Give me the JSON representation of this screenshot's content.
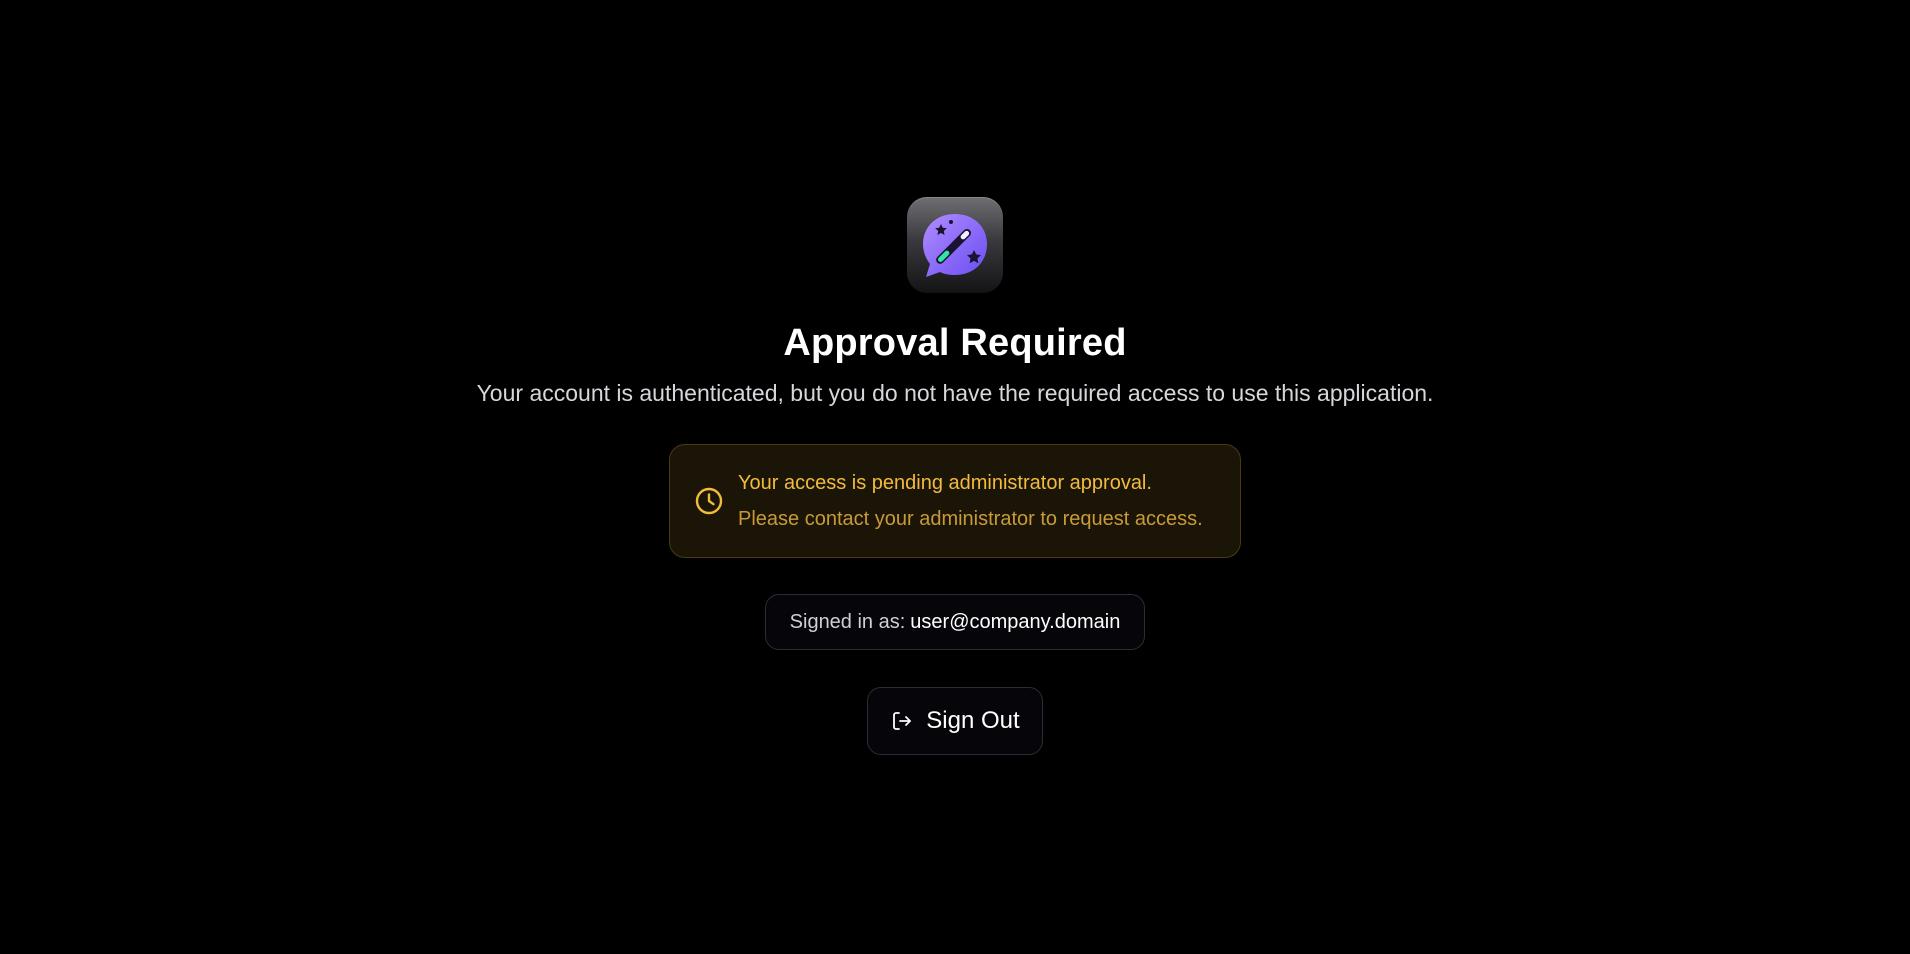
{
  "app": {
    "icon": "magic-wand-chat-icon"
  },
  "header": {
    "title": "Approval Required",
    "subtitle": "Your account is authenticated, but you do not have the required access to use this application."
  },
  "notice": {
    "icon": "clock-icon",
    "line1": "Your access is pending administrator approval.",
    "line2": "Please contact your administrator to request access.",
    "accent_color": "#f2bb3c"
  },
  "account": {
    "label": "Signed in as:",
    "email": "user@company.domain"
  },
  "actions": {
    "sign_out_icon": "sign-out-icon",
    "sign_out_label": "Sign Out"
  },
  "colors": {
    "background": "#000000",
    "brand_gradient_start": "#a78bfa",
    "brand_gradient_end": "#6d4cf0"
  }
}
